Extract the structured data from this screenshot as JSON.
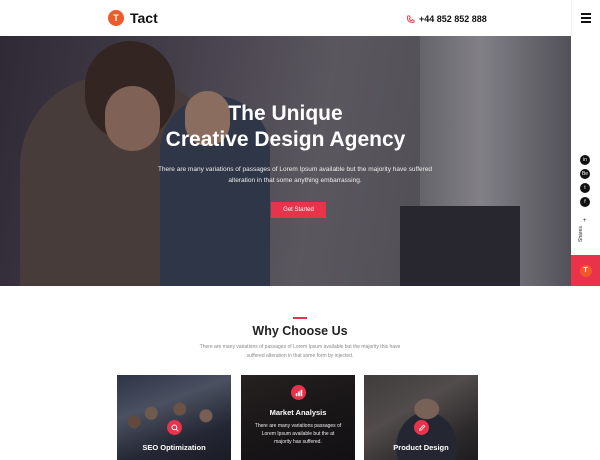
{
  "header": {
    "logo_letter": "T",
    "brand": "Tact",
    "phone": "+44 852 852 888"
  },
  "hero": {
    "title_line1": "The Unique",
    "title_line2": "Creative Design Agency",
    "subtitle": "There are many variations of passages of Lorem Ipsum available but the majority have suffered alteration in that some anything embarrassing.",
    "cta": "Get Started"
  },
  "side": {
    "social_icons": [
      "linkedin-icon",
      "behance-icon",
      "twitter-icon",
      "facebook-icon"
    ],
    "social_glyphs": [
      "in",
      "Be",
      "t",
      "f"
    ],
    "shares_label": "Shares",
    "plus": "+",
    "cta_letter": "T"
  },
  "why": {
    "title": "Why Choose Us",
    "subtitle": "There are many variations of passages of Lorem Ipsum available but the majority this have suffered alteration in that some form by injected."
  },
  "cards": [
    {
      "title": "SEO Optimization",
      "text": ""
    },
    {
      "title": "Market Analysis",
      "text": "There are many variations passages of Lorem Ipsum available but the at majority has suffered."
    },
    {
      "title": "Product Design",
      "text": ""
    }
  ],
  "colors": {
    "accent": "#e8334a",
    "logo": "#ef5a2a"
  }
}
